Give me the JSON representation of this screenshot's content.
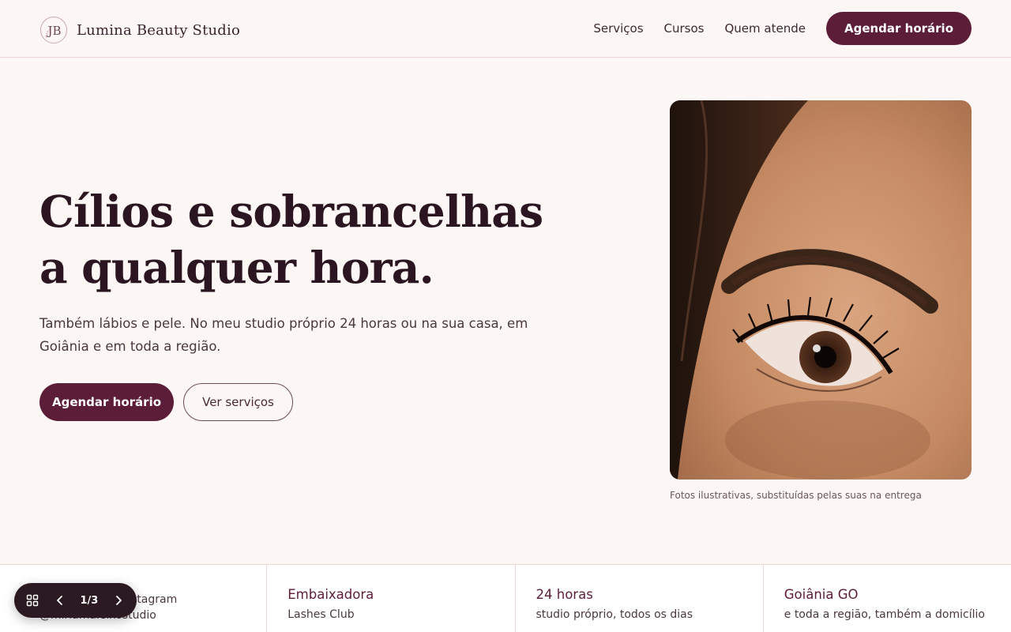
{
  "header": {
    "brand_name": "Lumina Beauty Studio",
    "logo_text": "JB",
    "nav": [
      "Serviços",
      "Cursos",
      "Quem atende"
    ],
    "cta": "Agendar horário"
  },
  "hero": {
    "title_line1": "Cílios e sobrancelhas",
    "title_line2": "a qualquer hora.",
    "subtitle": "Também lábios e pele. No meu studio próprio 24 horas ou na sua casa, em Goiânia e em toda a região.",
    "primary_button": "Agendar horário",
    "secondary_button": "Ver serviços",
    "photo_caption": "Fotos ilustrativas, substituídas pelas suas na entrega"
  },
  "stats": [
    {
      "title": "",
      "desc": "seguidoras no Instagram",
      "desc2": "@miriamaleixostudio"
    },
    {
      "title": "Embaixadora",
      "desc": "Lashes Club"
    },
    {
      "title": "24 horas",
      "desc": "studio próprio, todos os dias"
    },
    {
      "title": "Goiânia GO",
      "desc": "e toda a região, também a domicílio"
    }
  ],
  "pager": {
    "counter": "1/3",
    "icons": [
      "grid-icon",
      "chevron-left-icon",
      "chevron-right-icon"
    ]
  },
  "colors": {
    "accent": "#5c1d39",
    "background": "#fcf6f4",
    "border": "#ecd6d8",
    "pager_bg": "#2b1a22"
  }
}
